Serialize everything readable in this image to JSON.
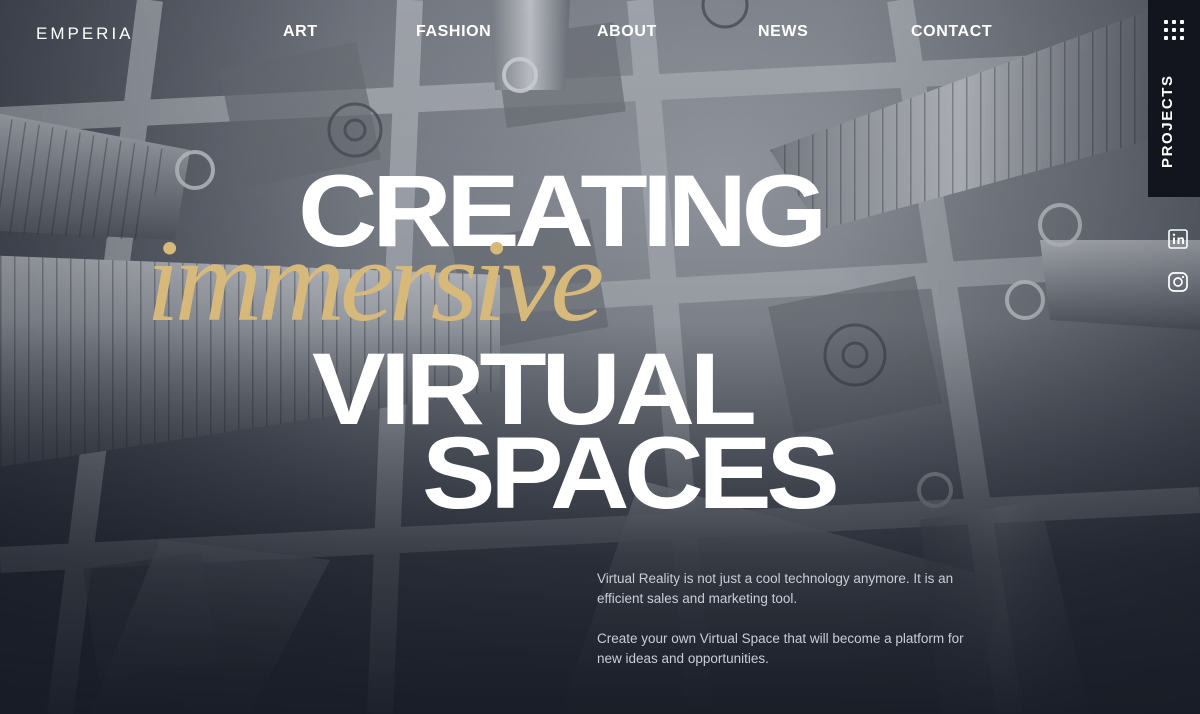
{
  "header": {
    "logo": "EMPERIA",
    "nav": [
      {
        "label": "ART"
      },
      {
        "label": "FASHION"
      },
      {
        "label": "ABOUT"
      },
      {
        "label": "NEWS"
      },
      {
        "label": "CONTACT"
      }
    ]
  },
  "rail": {
    "menu_icon": "grid-dots-icon",
    "projects_label": "PROJECTS",
    "social": [
      {
        "name": "linkedin-icon"
      },
      {
        "name": "instagram-icon"
      }
    ]
  },
  "hero": {
    "line1": "CREATING",
    "line2": "immersive",
    "line3": "VIRTUAL",
    "line4": "SPACES",
    "paragraph1": "Virtual Reality is not just a cool technology anymore. It is an efficient sales and marketing tool.",
    "paragraph2": "Create your own Virtual Space that will become a platform for new ideas and opportunities."
  },
  "colors": {
    "accent_gold": "#d7b97c",
    "text_white": "#ffffff",
    "rail_bg": "#12151d",
    "body_text": "#c9cdd6"
  }
}
